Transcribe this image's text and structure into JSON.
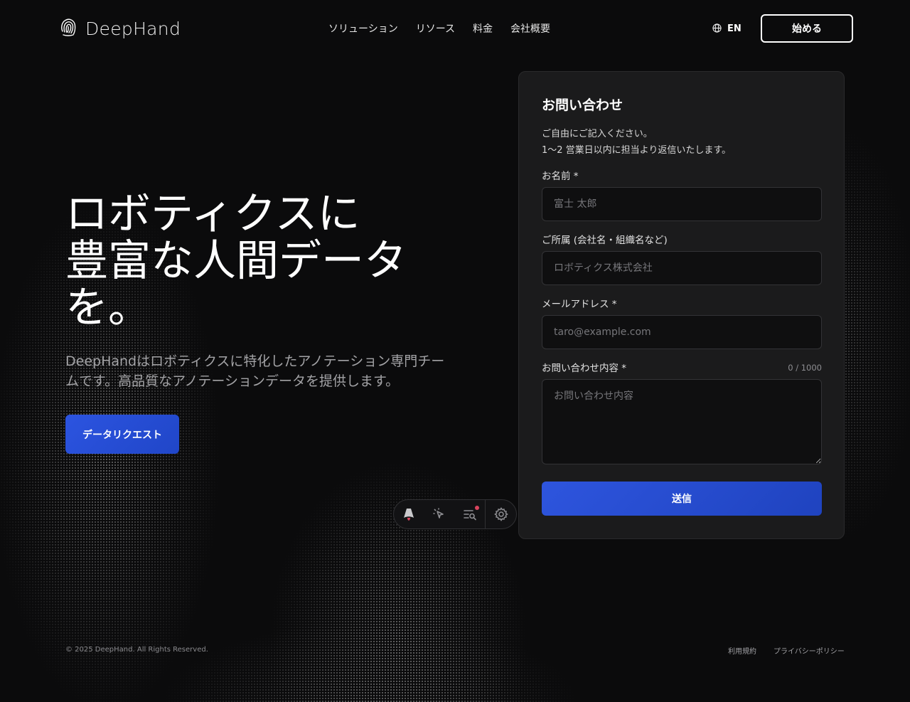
{
  "colors": {
    "background": "#0b0b0c",
    "card": "#1b1b1c",
    "accent": "#2c54e0"
  },
  "header": {
    "logo_icon": "fingerprint-icon",
    "brand": "DeepHand",
    "nav": [
      {
        "label": "ソリューション"
      },
      {
        "label": "リソース"
      },
      {
        "label": "料金"
      },
      {
        "label": "会社概要"
      }
    ],
    "language_icon": "globe-icon",
    "language": "EN",
    "start_label": "始める"
  },
  "hero": {
    "title_lines": [
      "ロボティクスに",
      "豊富な人間データ",
      "を。"
    ],
    "subtitle": "DeepHandはロボティクスに特化したアノテーション専門チームです。高品質なアノテーションデータを提供します。",
    "cta_label": "データリクエスト"
  },
  "contact_form": {
    "title": "お問い合わせ",
    "description_lines": [
      "ご自由にご記入ください。",
      "1〜2 営業日以内に担当より返信いたします。"
    ],
    "fields": [
      {
        "label": "お名前",
        "required": "*",
        "placeholder": "富士 太郎",
        "value": ""
      },
      {
        "label": "ご所属 (会社名・組織名など)",
        "required": "",
        "placeholder": "ロボティクス株式会社",
        "value": ""
      },
      {
        "label": "メールアドレス",
        "required": "*",
        "placeholder": "taro@example.com",
        "value": ""
      },
      {
        "label": "お問い合わせ内容",
        "required": "*",
        "placeholder": "お問い合わせ内容",
        "value": ""
      }
    ],
    "counter": "0 / 1000",
    "submit_label": "送信"
  },
  "dev_toolbar": {
    "icons": [
      "astro-logo-icon",
      "cursor-inspect-icon",
      "audit-list-icon",
      "settings-gear-icon"
    ]
  },
  "footer": {
    "copyright": "© 2025 DeepHand. All Rights Reserved.",
    "links": [
      {
        "label": "利用規約"
      },
      {
        "label": "プライバシーポリシー"
      }
    ]
  }
}
